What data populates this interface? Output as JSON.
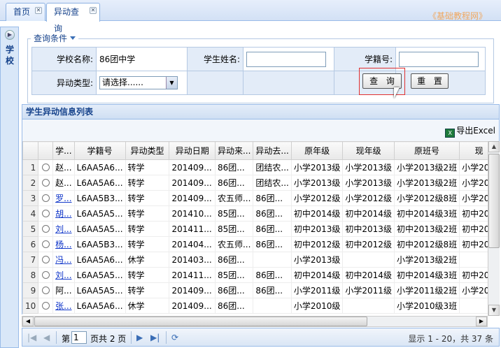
{
  "tabs": [
    {
      "label": "首页"
    },
    {
      "label": "异动查询"
    }
  ],
  "watermark": "《基础教程网》",
  "left_panel": {
    "title": "学校"
  },
  "query": {
    "legend": "查询条件",
    "school_label": "学校名称:",
    "school_value": "86团中学",
    "student_name_label": "学生姓名:",
    "student_id_label": "学籍号:",
    "change_type_label": "异动类型:",
    "change_type_value": "请选择......",
    "search_button": "查 询",
    "reset_button": "重 置"
  },
  "grid": {
    "title": "学生异动信息列表",
    "export_label": "导出Excel",
    "columns": [
      "学...",
      "学籍号",
      "异动类型",
      "异动日期",
      "异动来...",
      "异动去...",
      "原年级",
      "现年级",
      "原班号",
      "现"
    ],
    "rows": [
      {
        "n": "1",
        "name": "赵...",
        "id": "L6AA5A6...",
        "type": "转学",
        "date": "201409...",
        "from": "86团...",
        "to": "团结农...",
        "og": "小学2013级",
        "ng": "小学2013级",
        "oc": "小学2013级2班",
        "nc": "小学20",
        "link": false
      },
      {
        "n": "2",
        "name": "赵...",
        "id": "L6AA5A6...",
        "type": "转学",
        "date": "201409...",
        "from": "86团...",
        "to": "团结农...",
        "og": "小学2013级",
        "ng": "小学2013级",
        "oc": "小学2013级2班",
        "nc": "小学20",
        "link": false
      },
      {
        "n": "3",
        "name": "罗...",
        "id": "L6AA5B3...",
        "type": "转学",
        "date": "201409...",
        "from": "农五师...",
        "to": "86团...",
        "og": "小学2012级",
        "ng": "小学2012级",
        "oc": "小学2012级8班",
        "nc": "小学20",
        "link": true
      },
      {
        "n": "4",
        "name": "胡...",
        "id": "L6AA5A5...",
        "type": "转学",
        "date": "201410...",
        "from": "85团...",
        "to": "86团...",
        "og": "初中2014级",
        "ng": "初中2014级",
        "oc": "初中2014级3班",
        "nc": "初中20",
        "link": true
      },
      {
        "n": "5",
        "name": "刘...",
        "id": "L6AA5A5...",
        "type": "转学",
        "date": "201411...",
        "from": "85团...",
        "to": "86团...",
        "og": "初中2013级",
        "ng": "初中2013级",
        "oc": "初中2013级2班",
        "nc": "初中20",
        "link": true
      },
      {
        "n": "6",
        "name": "杨...",
        "id": "L6AA5B3...",
        "type": "转学",
        "date": "201404...",
        "from": "农五师...",
        "to": "86团...",
        "og": "初中2012级",
        "ng": "初中2012级",
        "oc": "初中2012级8班",
        "nc": "初中20",
        "link": true
      },
      {
        "n": "7",
        "name": "冯...",
        "id": "L6AA5A6...",
        "type": "休学",
        "date": "201403...",
        "from": "86团...",
        "to": "",
        "og": "小学2013级",
        "ng": "",
        "oc": "小学2013级2班",
        "nc": "",
        "link": true
      },
      {
        "n": "8",
        "name": "刘...",
        "id": "L6AA5A5...",
        "type": "转学",
        "date": "201411...",
        "from": "85团...",
        "to": "86团...",
        "og": "初中2014级",
        "ng": "初中2014级",
        "oc": "初中2014级3班",
        "nc": "初中20",
        "link": true
      },
      {
        "n": "9",
        "name": "阿...",
        "id": "L6AA5A5...",
        "type": "转学",
        "date": "201409...",
        "from": "86团...",
        "to": "86团...",
        "og": "小学2011级",
        "ng": "小学2011级",
        "oc": "小学2011级2班",
        "nc": "小学20",
        "link": false
      },
      {
        "n": "10",
        "name": "张...",
        "id": "L6AA5A6...",
        "type": "休学",
        "date": "201409...",
        "from": "86团...",
        "to": "",
        "og": "小学2010级",
        "ng": "",
        "oc": "小学2010级3班",
        "nc": "",
        "link": true
      }
    ]
  },
  "pager": {
    "page_prefix": "第",
    "page_value": "1",
    "page_suffix": "页共 2 页",
    "info": "显示 1 - 20，共 37 条"
  },
  "colors": {
    "accent": "#15428b",
    "header_bg": "#d3e1f5",
    "highlight": "#e03030",
    "link": "#1036c9"
  }
}
